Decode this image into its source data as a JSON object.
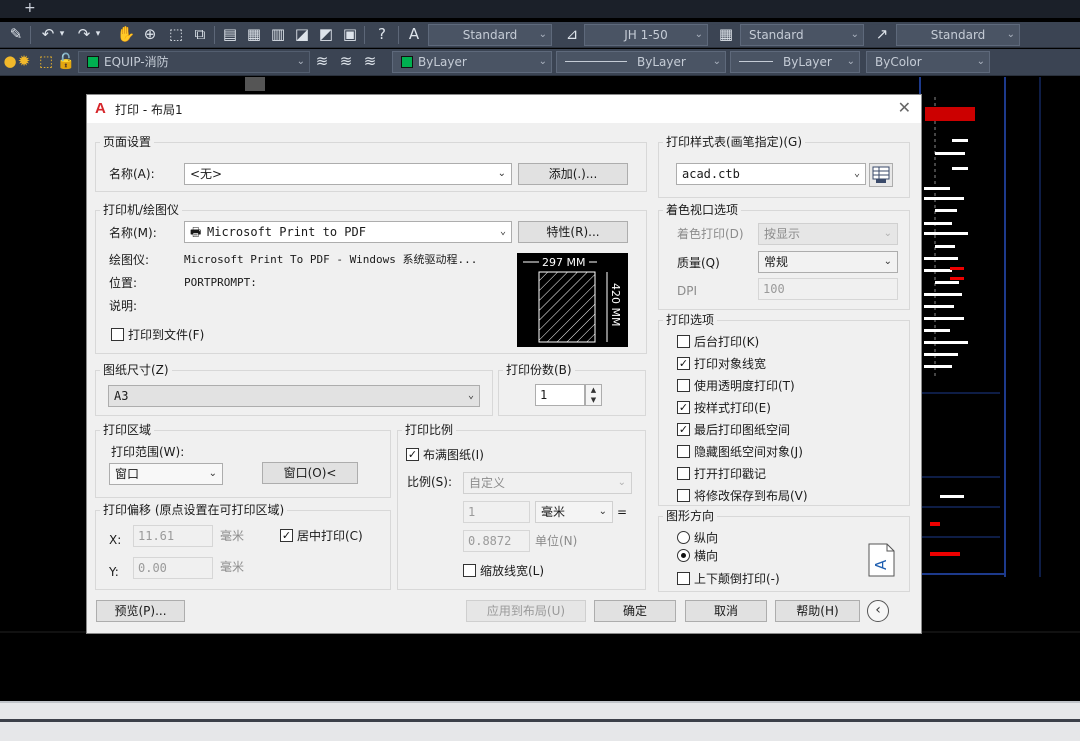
{
  "app": {
    "toolbar1": {
      "text_style": "Standard",
      "dim_style": "JH 1-50",
      "table_style": "Standard",
      "mleader_style": "Standard"
    },
    "toolbar2": {
      "layer": "EQUIP-消防",
      "color": "ByLayer",
      "linetype": "ByLayer",
      "lineweight": "ByLayer",
      "plotstyle": "ByColor",
      "layer_color": "#00b050"
    }
  },
  "dialog": {
    "title": "打印 - 布局1",
    "page_setup": {
      "title": "页面设置",
      "name_label": "名称(A):",
      "name_value": "<无>",
      "add_button": "添加(.)..."
    },
    "printer": {
      "title": "打印机/绘图仪",
      "name_label": "名称(M):",
      "name_value": "Microsoft Print to PDF",
      "properties_button": "特性(R)...",
      "plotter_label": "绘图仪:",
      "plotter_value": "Microsoft Print To PDF - Windows 系统驱动程...",
      "location_label": "位置:",
      "location_value": "PORTPROMPT:",
      "description_label": "说明:",
      "print_to_file_label": "打印到文件(F)",
      "print_to_file_checked": false,
      "preview_width_label": "297 MM",
      "preview_height_label": "420 MM"
    },
    "paper_size": {
      "title": "图纸尺寸(Z)",
      "value": "A3"
    },
    "copies": {
      "title": "打印份数(B)",
      "value": "1"
    },
    "plot_area": {
      "title": "打印区域",
      "range_label": "打印范围(W):",
      "range_value": "窗口",
      "window_button": "窗口(O)<"
    },
    "plot_offset": {
      "title": "打印偏移 (原点设置在可打印区域)",
      "x_label": "X:",
      "x_value": "11.61",
      "y_label": "Y:",
      "y_value": "0.00",
      "unit": "毫米",
      "center_label": "居中打印(C)",
      "center_checked": true
    },
    "plot_scale": {
      "title": "打印比例",
      "fit_label": "布满图纸(I)",
      "fit_checked": true,
      "scale_label": "比例(S):",
      "scale_value": "自定义",
      "value1": "1",
      "unit_value": "毫米",
      "equals": "=",
      "value2": "0.8872",
      "unit2_label": "单位(N)",
      "lineweights_label": "缩放线宽(L)",
      "lineweights_checked": false
    },
    "plot_style_table": {
      "title": "打印样式表(画笔指定)(G)",
      "value": "acad.ctb"
    },
    "shaded_viewport": {
      "title": "着色视口选项",
      "shade_label": "着色打印(D)",
      "shade_value": "按显示",
      "quality_label": "质量(Q)",
      "quality_value": "常规",
      "dpi_label": "DPI",
      "dpi_value": "100"
    },
    "plot_options": {
      "title": "打印选项",
      "items": [
        {
          "label": "后台打印(K)",
          "checked": false
        },
        {
          "label": "打印对象线宽",
          "checked": true
        },
        {
          "label": "使用透明度打印(T)",
          "checked": false
        },
        {
          "label": "按样式打印(E)",
          "checked": true
        },
        {
          "label": "最后打印图纸空间",
          "checked": true
        },
        {
          "label": "隐藏图纸空间对象(J)",
          "checked": false
        },
        {
          "label": "打开打印戳记",
          "checked": false
        },
        {
          "label": "将修改保存到布局(V)",
          "checked": false
        }
      ]
    },
    "orientation": {
      "title": "图形方向",
      "portrait_label": "纵向",
      "portrait_selected": false,
      "landscape_label": "横向",
      "landscape_selected": true,
      "upside_down_label": "上下颠倒打印(-)",
      "upside_down_checked": false
    },
    "buttons": {
      "preview": "预览(P)...",
      "apply": "应用到布局(U)",
      "ok": "确定",
      "cancel": "取消",
      "help": "帮助(H)"
    }
  }
}
